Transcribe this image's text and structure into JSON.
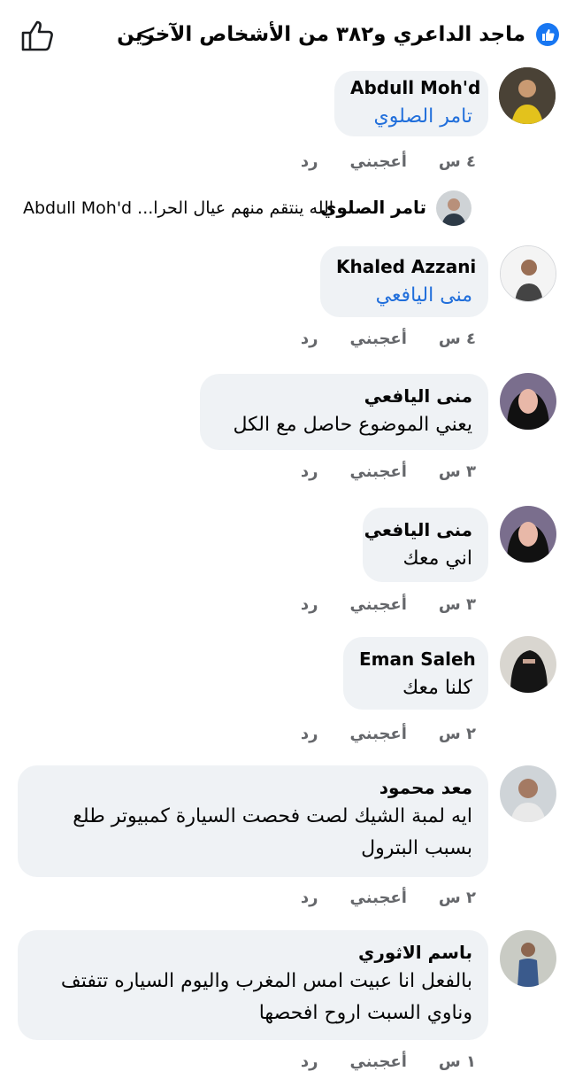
{
  "header": {
    "title": "ماجد الداعري و٣٨٢ من الأشخاص الآخرين",
    "chevron": "<"
  },
  "comments": [
    {
      "name": "Abdull Moh'd",
      "text": "تامر الصلوي",
      "tag": true,
      "time": "٤ س",
      "like": "أعجبني",
      "reply": "رد"
    },
    {
      "name": "Khaled Azzani",
      "text": "منى اليافعي",
      "tag": true,
      "time": "٤ س",
      "like": "أعجبني",
      "reply": "رد"
    },
    {
      "name": "منى اليافعي",
      "text": "يعني الموضوع حاصل مع الكل",
      "time": "٣ س",
      "like": "أعجبني",
      "reply": "رد"
    },
    {
      "name": "منى اليافعي",
      "text": "اني معك",
      "time": "٣ س",
      "like": "أعجبني",
      "reply": "رد"
    },
    {
      "name": "Eman Saleh",
      "text": "كلنا معك",
      "time": "٢ س",
      "like": "أعجبني",
      "reply": "رد"
    },
    {
      "name": "معد محمود",
      "text": "ايه لمبة الشيك لصت فحصت السيارة كمبيوتر طلع بسبب البترول",
      "time": "٢ س",
      "like": "أعجبني",
      "reply": "رد"
    },
    {
      "name": "باسم الاثوري",
      "text": "بالفعل انا عبيت امس المغرب واليوم السياره تتفتف وناوي السبت اروح افحصها",
      "time": "١ س",
      "like": "أعجبني",
      "reply": "رد"
    }
  ],
  "reply_preview": {
    "name": "تامر الصلوي",
    "text": "الله ينتقم منهم عيال الحرا... Abdull Moh'd"
  },
  "colors": {
    "tag": "#216fdb",
    "bubble": "#eff2f5",
    "meta": "#65676b",
    "like_badge": "#1877f2"
  }
}
